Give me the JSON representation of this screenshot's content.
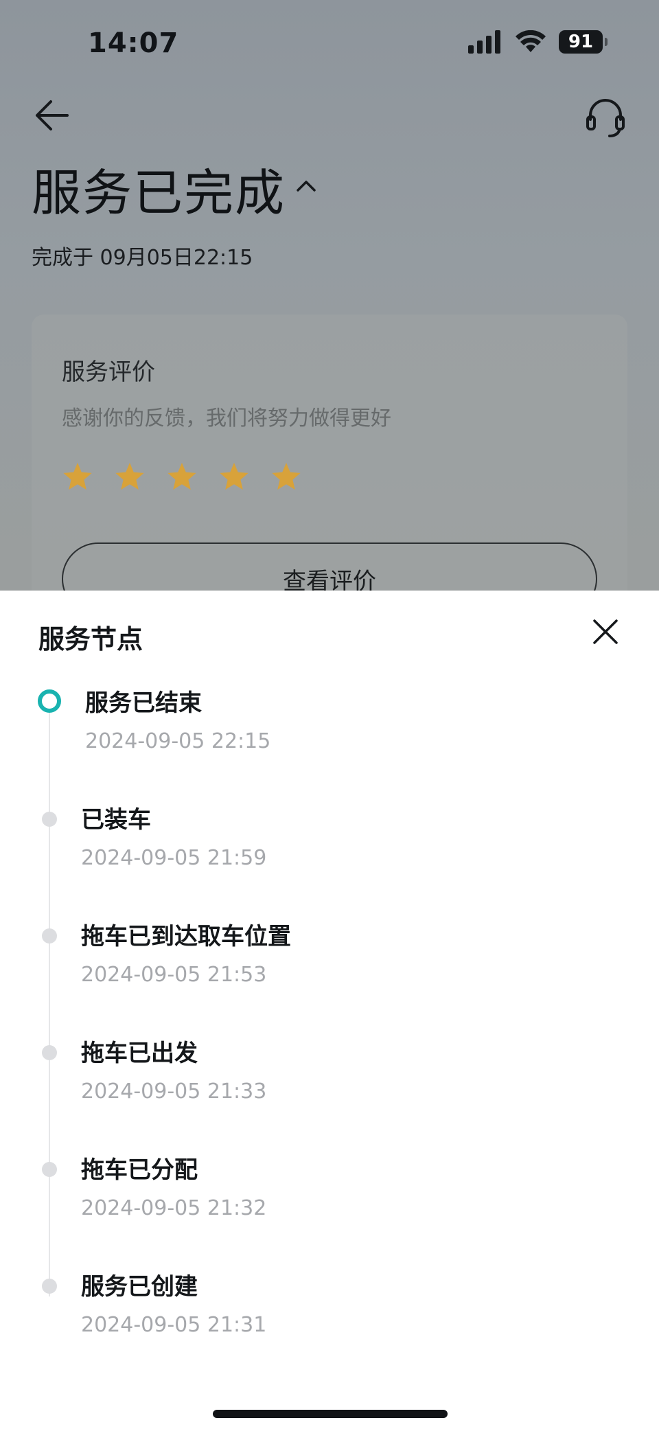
{
  "status_bar": {
    "time": "14:07",
    "battery": "91",
    "icons": [
      "signal-icon",
      "wifi-icon",
      "battery-icon"
    ]
  },
  "header": {
    "title": "服务已完成",
    "completed_at": "完成于 09月05日22:15",
    "icons": [
      "back-arrow-icon",
      "headset-icon",
      "chevron-up-icon"
    ]
  },
  "review": {
    "title": "服务评价",
    "subtitle": "感谢你的反馈，我们将努力做得更好",
    "rating": 5,
    "max_rating": 5,
    "star_color": "#d8a23a",
    "button_label": "查看评价"
  },
  "sheet": {
    "title": "服务节点",
    "accent_color": "#19b3b0",
    "nodes": [
      {
        "label": "服务已结束",
        "time": "2024-09-05 22:15",
        "active": true
      },
      {
        "label": "已装车",
        "time": "2024-09-05 21:59",
        "active": false
      },
      {
        "label": "拖车已到达取车位置",
        "time": "2024-09-05 21:53",
        "active": false
      },
      {
        "label": "拖车已出发",
        "time": "2024-09-05 21:33",
        "active": false
      },
      {
        "label": "拖车已分配",
        "time": "2024-09-05 21:32",
        "active": false
      },
      {
        "label": "服务已创建",
        "time": "2024-09-05 21:31",
        "active": false
      }
    ]
  }
}
